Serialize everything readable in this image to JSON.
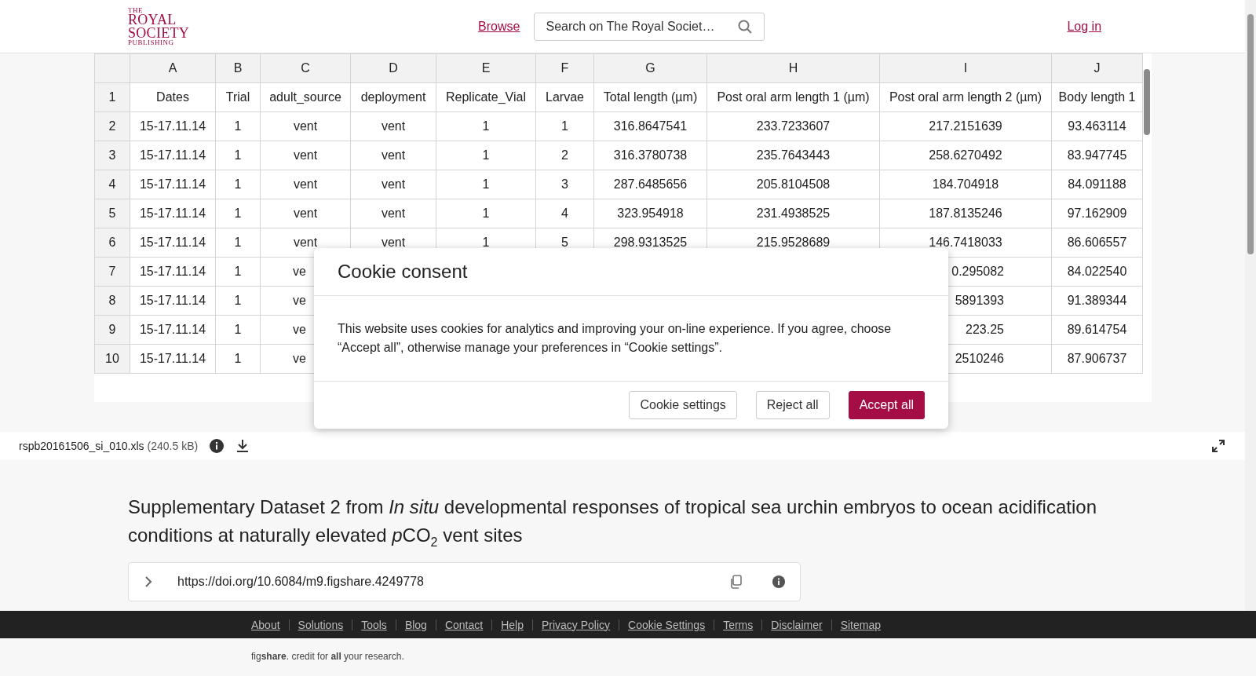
{
  "header": {
    "logo": [
      "THE",
      "ROYAL",
      "SOCIETY",
      "PUBLISHING"
    ],
    "browse_link": "Browse",
    "search": {
      "placeholder": "Search on The Royal Societ…"
    },
    "login_link": "Log in"
  },
  "spreadsheet": {
    "columns": [
      "A",
      "B",
      "C",
      "D",
      "E",
      "F",
      "G",
      "H",
      "I",
      "J"
    ],
    "rows": [
      {
        "number": "1",
        "cells": [
          {
            "text": "Dates"
          },
          {
            "text": "Trial"
          },
          {
            "text": "adult_source"
          },
          {
            "text": "deployment"
          },
          {
            "text": "Replicate_Vial"
          },
          {
            "text": "Larvae"
          },
          {
            "text": "Total length (µm)"
          },
          {
            "text": "Post oral arm length 1 (µm)"
          },
          {
            "text": "Post oral arm length 2 (µm)"
          },
          {
            "text": "Body length 1"
          }
        ]
      },
      {
        "number": "2",
        "cells": [
          {
            "text": "15-17.11.14"
          },
          {
            "text": "1"
          },
          {
            "text": "vent"
          },
          {
            "text": "vent"
          },
          {
            "text": "1"
          },
          {
            "text": "1"
          },
          {
            "text": "316.8647541"
          },
          {
            "text": "233.7233607"
          },
          {
            "text": "217.2151639"
          },
          {
            "text": "93.463114"
          }
        ]
      },
      {
        "number": "3",
        "cells": [
          {
            "text": "15-17.11.14"
          },
          {
            "text": "1"
          },
          {
            "text": "vent"
          },
          {
            "text": "vent"
          },
          {
            "text": "1"
          },
          {
            "text": "2"
          },
          {
            "text": "316.3780738"
          },
          {
            "text": "235.7643443"
          },
          {
            "text": "258.6270492"
          },
          {
            "text": "83.947745"
          }
        ]
      },
      {
        "number": "4",
        "cells": [
          {
            "text": "15-17.11.14"
          },
          {
            "text": "1"
          },
          {
            "text": "vent"
          },
          {
            "text": "vent"
          },
          {
            "text": "1"
          },
          {
            "text": "3"
          },
          {
            "text": "287.6485656"
          },
          {
            "text": "205.8104508"
          },
          {
            "text": "184.704918"
          },
          {
            "text": "84.091188"
          }
        ]
      },
      {
        "number": "5",
        "cells": [
          {
            "text": "15-17.11.14"
          },
          {
            "text": "1"
          },
          {
            "text": "vent"
          },
          {
            "text": "vent"
          },
          {
            "text": "1"
          },
          {
            "text": "4"
          },
          {
            "text": "323.954918"
          },
          {
            "text": "231.4938525"
          },
          {
            "text": "187.8135246"
          },
          {
            "text": "97.162909"
          }
        ]
      },
      {
        "number": "6",
        "cells": [
          {
            "text": "15-17.11.14"
          },
          {
            "text": "1"
          },
          {
            "text": "vent"
          },
          {
            "text": "vent"
          },
          {
            "text": "1"
          },
          {
            "text": "5"
          },
          {
            "text": "298.9313525"
          },
          {
            "text": "215.9528689"
          },
          {
            "text": "146.7418033"
          },
          {
            "text": "86.606557"
          }
        ]
      },
      {
        "number": "7",
        "cells": [
          {
            "text": "15-17.11.14"
          },
          {
            "text": "1"
          },
          {
            "text": "ve"
          },
          null,
          null,
          null,
          null,
          null,
          {
            "text": "0.295082"
          },
          {
            "text": "84.022540"
          }
        ]
      },
      {
        "number": "8",
        "cells": [
          {
            "text": "15-17.11.14"
          },
          {
            "text": "1"
          },
          {
            "text": "ve"
          },
          null,
          null,
          null,
          null,
          null,
          {
            "text": "5891393"
          },
          {
            "text": "91.389344"
          }
        ]
      },
      {
        "number": "9",
        "cells": [
          {
            "text": "15-17.11.14"
          },
          {
            "text": "1"
          },
          {
            "text": "ve"
          },
          null,
          null,
          null,
          null,
          null,
          {
            "text": "223.25"
          },
          {
            "text": "89.614754"
          }
        ]
      },
      {
        "number": "10",
        "cells": [
          {
            "text": "15-17.11.14"
          },
          {
            "text": "1"
          },
          {
            "text": "ve"
          },
          null,
          null,
          null,
          null,
          null,
          {
            "text": "2510246"
          },
          {
            "text": "87.906737"
          }
        ]
      }
    ]
  },
  "file_bar": {
    "filename": "rspb20161506_si_010.xls",
    "size": "(240.5 kB)"
  },
  "dataset": {
    "title": [
      {
        "text": "Supplementary Dataset 2 from ",
        "kind": "plain"
      },
      {
        "text": "In situ",
        "kind": "italic"
      },
      {
        "text": " developmental responses of tropical sea urchin embryos to ocean acidification conditions at naturally elevated ",
        "kind": "plain"
      },
      {
        "text": "p",
        "kind": "italic"
      },
      {
        "text": "CO",
        "kind": "plain"
      },
      {
        "text": "2",
        "kind": "subscript"
      },
      {
        "text": " vent sites",
        "kind": "plain"
      }
    ],
    "doi": "https://doi.org/10.6084/m9.figshare.4249778"
  },
  "footer": {
    "links": [
      "About",
      "Solutions",
      "Tools",
      "Blog",
      "Contact",
      "Help",
      "Privacy Policy",
      "Cookie Settings",
      "Terms",
      "Disclaimer",
      "Sitemap"
    ],
    "tagline": "fig**share**. credit for **all** your research."
  },
  "cookie_dialog": {
    "title": "Cookie consent",
    "message": "This website uses cookies for analytics and improving your on-line experience. If you agree, choose “Accept all”, otherwise manage your preferences in “Cookie settings”.",
    "buttons": [
      {
        "label": "Cookie settings",
        "kind": "secondary"
      },
      {
        "label": "Reject all",
        "kind": "secondary"
      },
      {
        "label": "Accept all",
        "kind": "primary"
      }
    ]
  }
}
